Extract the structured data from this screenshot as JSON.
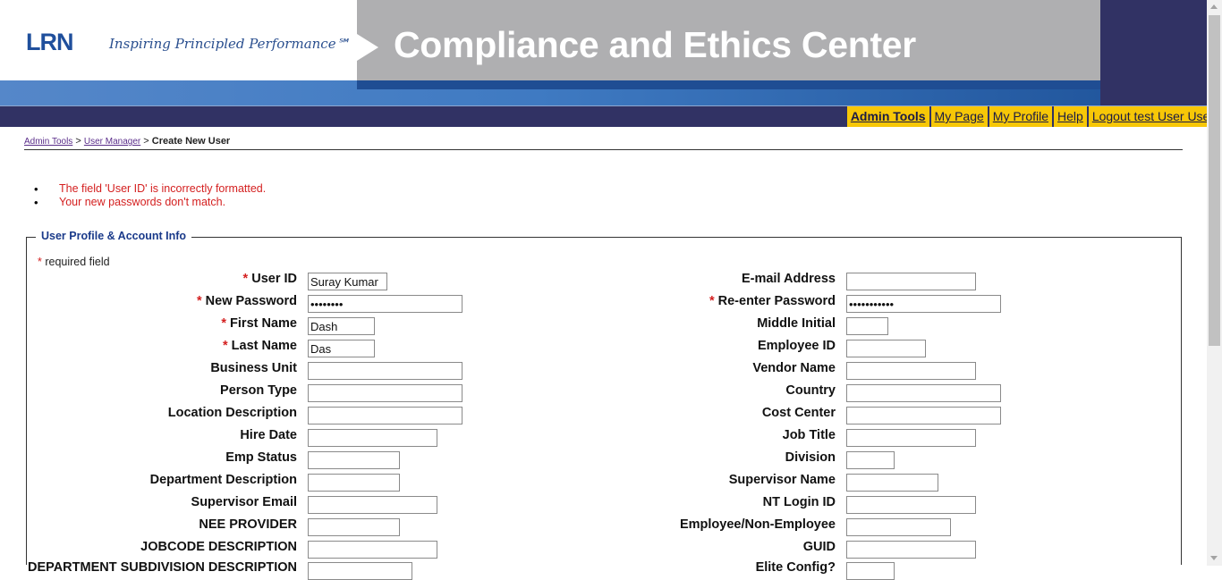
{
  "header": {
    "logo": "LRN",
    "tagline": "Inspiring Principled Performance℠",
    "title": "Compliance and Ethics Center"
  },
  "nav": {
    "admin_tools": "Admin Tools",
    "my_page": "My Page",
    "my_profile": "My Profile",
    "help": "Help",
    "logout": "Logout test User User"
  },
  "breadcrumb": {
    "admin_tools": "Admin Tools",
    "sep1": ">",
    "user_manager": "User Manager",
    "sep2": ">",
    "current": "Create New User"
  },
  "errors": [
    "The field 'User ID' is incorrectly formatted.",
    "Your new passwords don't match."
  ],
  "form": {
    "legend": "User Profile & Account Info",
    "required_star": "*",
    "required_note": " required field",
    "fields": {
      "user_id": {
        "label": "User ID",
        "value": "Suray Kumar"
      },
      "email": {
        "label": "E-mail Address",
        "value": ""
      },
      "new_password": {
        "label": "New Password",
        "value": "••••••••"
      },
      "reenter_password": {
        "label": "Re-enter Password",
        "value": "•••••••••••"
      },
      "first_name": {
        "label": "First Name",
        "value": "Dash"
      },
      "middle_initial": {
        "label": "Middle Initial",
        "value": ""
      },
      "last_name": {
        "label": "Last Name",
        "value": "Das"
      },
      "employee_id": {
        "label": "Employee ID",
        "value": ""
      },
      "business_unit": {
        "label": "Business Unit",
        "value": ""
      },
      "vendor_name": {
        "label": "Vendor Name",
        "value": ""
      },
      "person_type": {
        "label": "Person Type",
        "value": ""
      },
      "country": {
        "label": "Country",
        "value": ""
      },
      "location_description": {
        "label": "Location Description",
        "value": ""
      },
      "cost_center": {
        "label": "Cost Center",
        "value": ""
      },
      "hire_date": {
        "label": "Hire Date",
        "value": ""
      },
      "job_title": {
        "label": "Job Title",
        "value": ""
      },
      "emp_status": {
        "label": "Emp Status",
        "value": ""
      },
      "division": {
        "label": "Division",
        "value": ""
      },
      "department_description": {
        "label": "Department Description",
        "value": ""
      },
      "supervisor_name": {
        "label": "Supervisor Name",
        "value": ""
      },
      "supervisor_email": {
        "label": "Supervisor Email",
        "value": ""
      },
      "nt_login_id": {
        "label": "NT Login ID",
        "value": ""
      },
      "nee_provider": {
        "label": "NEE PROVIDER",
        "value": ""
      },
      "employee_non_employee": {
        "label": "Employee/Non-Employee",
        "value": ""
      },
      "jobcode_description": {
        "label": "JOBCODE DESCRIPTION",
        "value": ""
      },
      "guid": {
        "label": "GUID",
        "value": ""
      },
      "department_subdivision_description": {
        "label": "DEPARTMENT SUBDIVISION DESCRIPTION",
        "value": ""
      },
      "elite_config": {
        "label": "Elite Config?",
        "value": ""
      }
    }
  },
  "colors": {
    "nav_tab": "#f7c707",
    "nav_bar": "#313264",
    "error_text": "#d42020",
    "legend_text": "#1a3a8a",
    "header_grey": "#afafb1"
  }
}
